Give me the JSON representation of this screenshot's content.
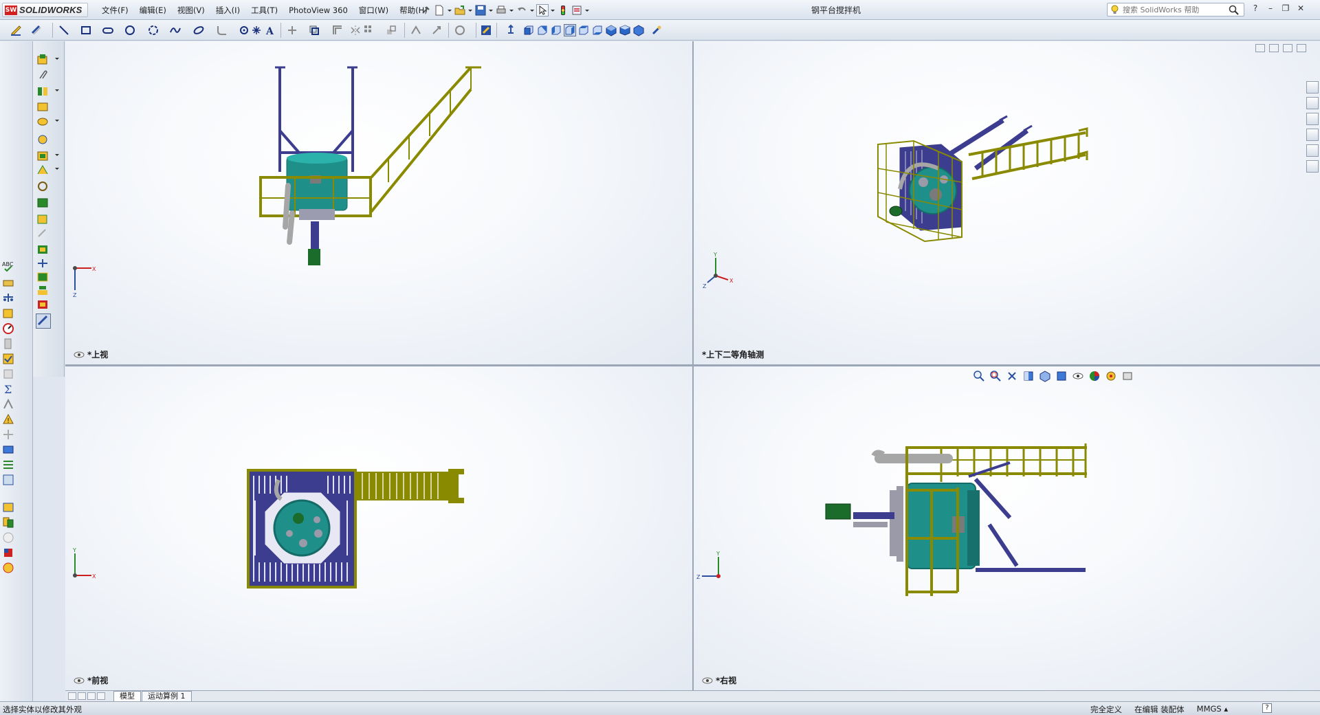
{
  "app": {
    "logo_badge": "SW",
    "logo_text": "SOLIDWORKS",
    "document_title": "钢平台搅拌机"
  },
  "menu": [
    "文件(F)",
    "编辑(E)",
    "视图(V)",
    "插入(I)",
    "工具(T)",
    "PhotoView 360",
    "窗口(W)",
    "帮助(H)"
  ],
  "help_search": {
    "placeholder": "搜索 SolidWorks 帮助"
  },
  "window_controls": {
    "help": "?",
    "minimize": "–",
    "restore": "❐",
    "close": "✕"
  },
  "viewports": {
    "top_left": {
      "label": "*上视"
    },
    "top_right": {
      "label": "*上下二等角轴测"
    },
    "bottom_left": {
      "label": "*前视"
    },
    "bottom_right": {
      "label": "*右视"
    }
  },
  "triad": {
    "x": "X",
    "y": "Y",
    "z": "Z"
  },
  "tabs": [
    "模型",
    "运动算例 1"
  ],
  "status": {
    "message": "选择实体以修改其外观",
    "definition": "完全定义",
    "editing": "在编辑 装配体",
    "units": "MMGS",
    "units_arrow": "▴",
    "help": "?"
  },
  "colors": {
    "frame_yellow": "#8a8a00",
    "structure_blue": "#3d3d8f",
    "tank_teal": "#1f8f8a",
    "motor_green": "#1b6b2a",
    "selection_red": "#cc1e1e"
  }
}
